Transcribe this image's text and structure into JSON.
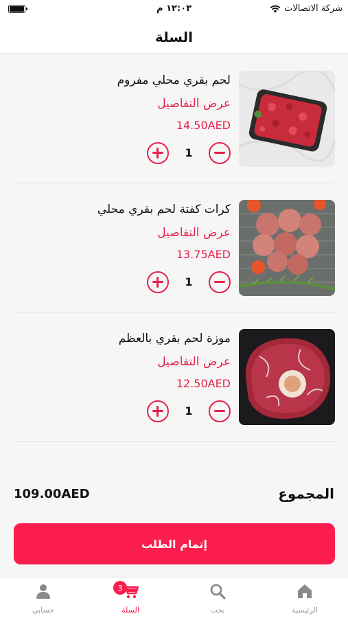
{
  "status_bar": {
    "time": "١٢:٠٣ م",
    "carrier": "شركة الاتصالات"
  },
  "header": {
    "title": "السلة"
  },
  "cart": {
    "items": [
      {
        "name": "لحم بقري محلي مفروم",
        "details_label": "عرض التفاصيل",
        "price": "14.50AED",
        "quantity": "1",
        "image_icon": "minced-beef"
      },
      {
        "name": "كرات كفتة لحم بقري محلي",
        "details_label": "عرض التفاصيل",
        "price": "13.75AED",
        "quantity": "1",
        "image_icon": "kofta-balls"
      },
      {
        "name": "موزة لحم بقري بالعظم",
        "details_label": "عرض التفاصيل",
        "price": "12.50AED",
        "quantity": "1",
        "image_icon": "beef-shank"
      }
    ]
  },
  "summary": {
    "total_label": "المجموع",
    "total_value": "109.00AED",
    "checkout_label": "إتمام الطلب"
  },
  "tab_bar": {
    "tabs": [
      {
        "label": "الرئيسية",
        "icon": "home-icon"
      },
      {
        "label": "بحث",
        "icon": "search-icon"
      },
      {
        "label": "السلة",
        "icon": "cart-icon",
        "badge": "3",
        "active": true
      },
      {
        "label": "حسابي",
        "icon": "user-icon"
      }
    ]
  },
  "colors": {
    "accent": "#fb1d4d",
    "accent_text": "#e8204a"
  }
}
